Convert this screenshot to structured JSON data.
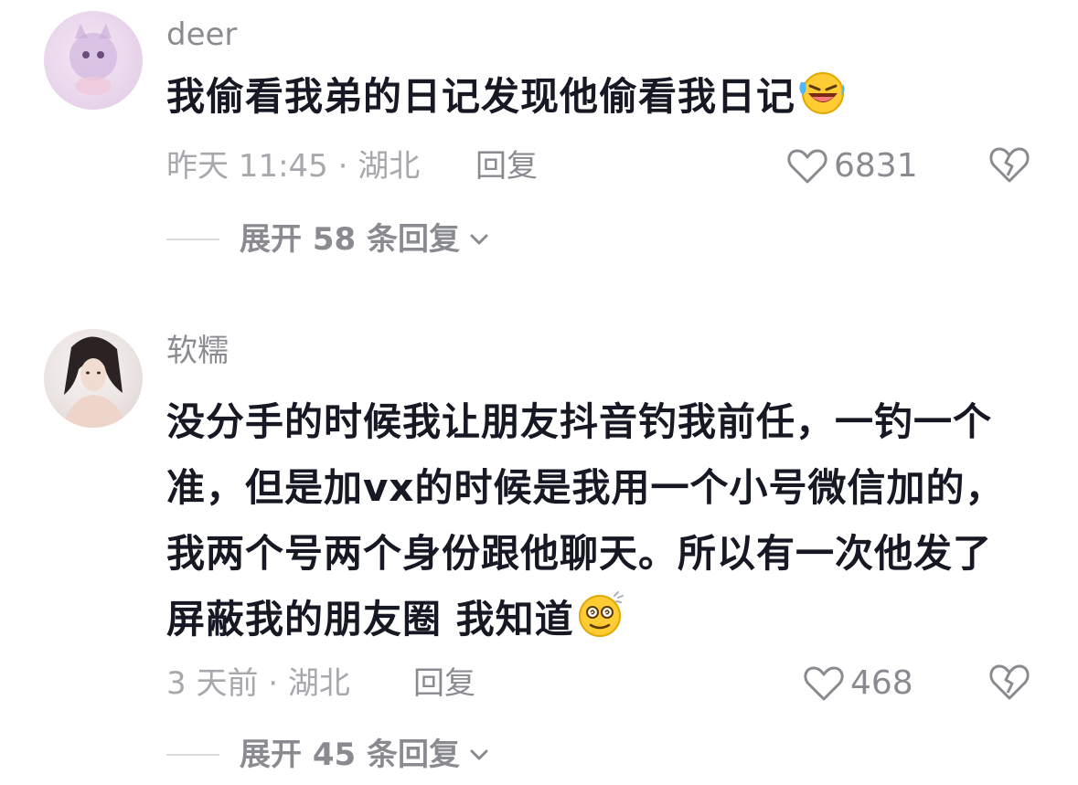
{
  "comments": [
    {
      "username": "deer",
      "text": "我偷看我弟的日记发现他偷看我日记",
      "emoji": "laughing-crying-emoji",
      "time_location": "昨天 11:45 · 湖北",
      "reply_label": "回复",
      "likes": "6831",
      "expand_label": "展开 58 条回复"
    },
    {
      "username": "软糯",
      "text": "没分手的时候我让朋友抖音钓我前任，一钓一个准，但是加vx的时候是我用一个小号微信加的，我两个号两个身份跟他聊天。所以有一次他发了屏蔽我的朋友圈 我知道",
      "emoji": "dizzy-smile-emoji",
      "time_location": "3 天前 · 湖北",
      "reply_label": "回复",
      "likes": "468",
      "expand_label": "展开 45 条回复"
    }
  ],
  "icons": {
    "like": "heart-outline-icon",
    "dislike": "broken-heart-icon",
    "expand": "chevron-down-icon"
  },
  "colors": {
    "text_primary": "#161823",
    "text_secondary": "#8a8b91",
    "text_tertiary": "#a7a8ad"
  }
}
